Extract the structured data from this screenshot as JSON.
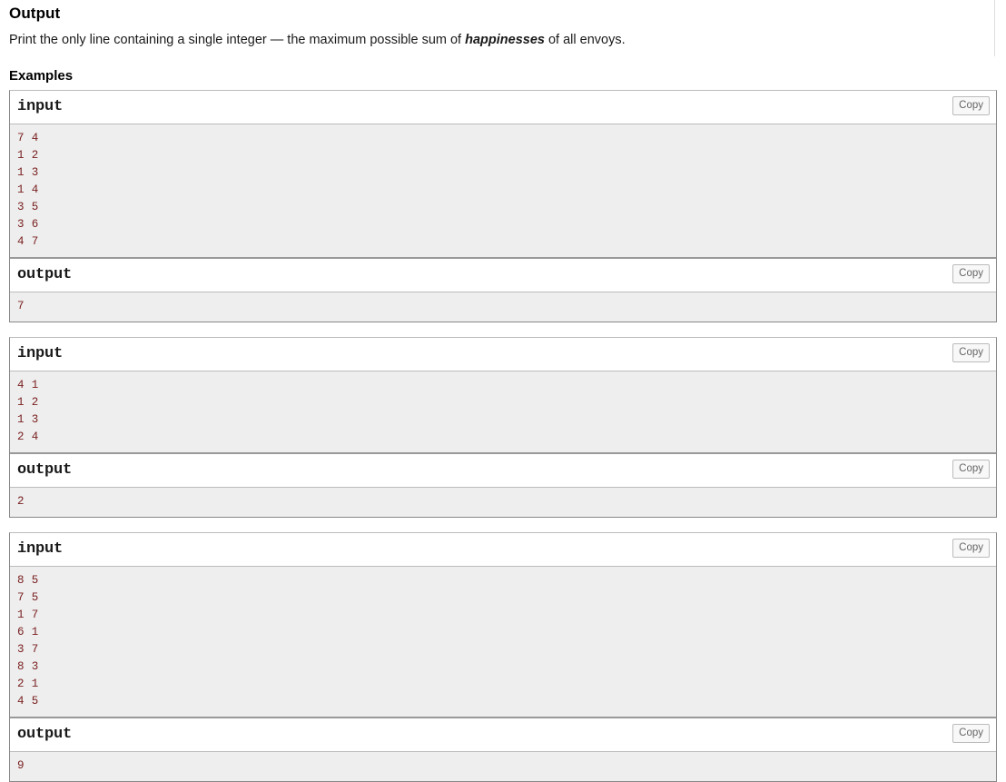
{
  "output_section": {
    "title": "Output",
    "description_before": "Print the only line containing a single integer  — the maximum possible sum of ",
    "description_emphasis": "happinesses",
    "description_after": " of all envoys."
  },
  "examples_section": {
    "title": "Examples",
    "copy_label": "Copy",
    "input_label": "input",
    "output_label": "output",
    "blocks": [
      {
        "input": "7 4\n1 2\n1 3\n1 4\n3 5\n3 6\n4 7",
        "output": "7"
      },
      {
        "input": "4 1\n1 2\n1 3\n2 4",
        "output": "2"
      },
      {
        "input": "8 5\n7 5\n1 7\n6 1\n3 7\n8 3\n2 1\n4 5",
        "output": "9"
      }
    ]
  },
  "colors": {
    "code_text": "#7a2020",
    "code_background": "#eeeeee",
    "block_border": "#888888",
    "page_background": "#ffffff"
  }
}
